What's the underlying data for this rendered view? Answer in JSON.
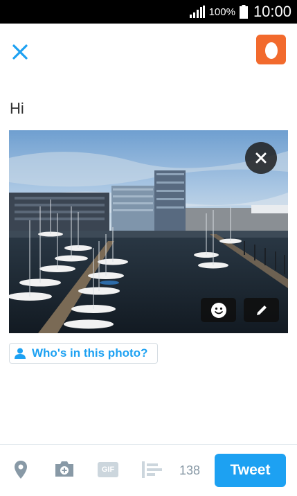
{
  "status_bar": {
    "battery_percent": "100%",
    "time": "10:00"
  },
  "header": {
    "close_icon": "close-icon",
    "avatar_icon": "egg-avatar-icon",
    "avatar_color": "#f26a2d"
  },
  "compose": {
    "text": "Hi"
  },
  "photo": {
    "subject": "harbor-with-sailboats-and-buildings",
    "remove_icon": "close-icon",
    "sticker_icon": "smiley-icon",
    "edit_icon": "pencil-icon"
  },
  "tag": {
    "label": "Who's in this photo?",
    "icon": "person-icon"
  },
  "toolbar": {
    "location_icon": "location-pin-icon",
    "camera_icon": "camera-icon",
    "gif_label": "GIF",
    "poll_icon": "poll-icon",
    "char_count": "138",
    "tweet_label": "Tweet"
  },
  "colors": {
    "accent": "#1da1f2",
    "muted": "#8899a6",
    "avatar": "#f26a2d"
  }
}
